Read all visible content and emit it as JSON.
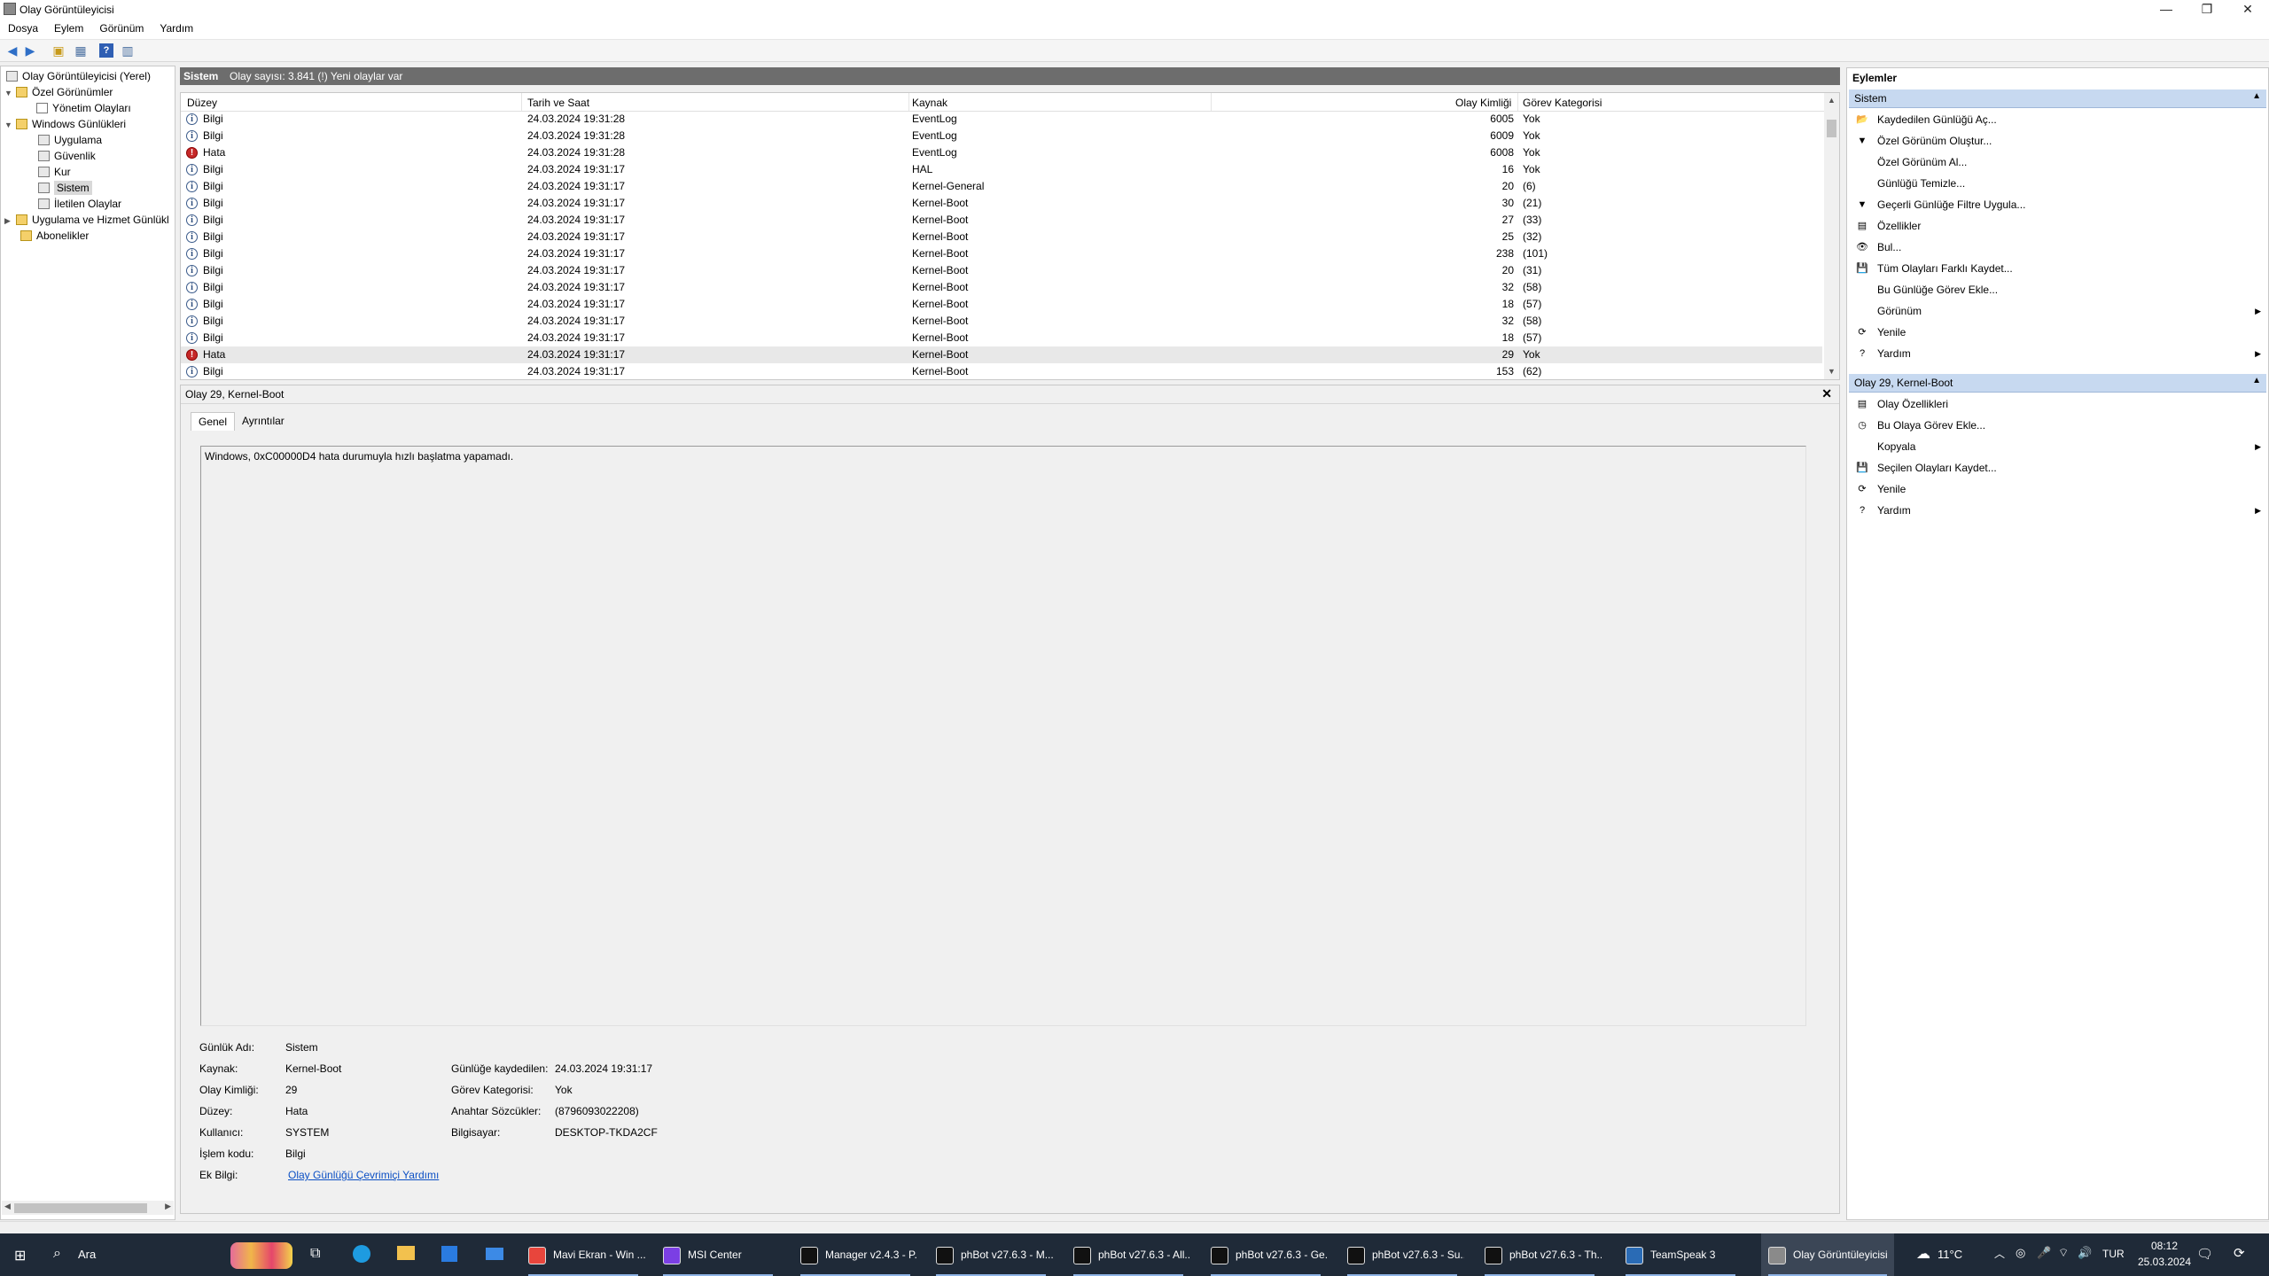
{
  "window": {
    "title": "Olay Görüntüleyicisi",
    "minimize_glyph": "—",
    "restore_glyph": "❐",
    "close_glyph": "✕"
  },
  "menu": [
    "Dosya",
    "Eylem",
    "Görünüm",
    "Yardım"
  ],
  "tree": {
    "root": "Olay Görüntüleyicisi (Yerel)",
    "custom_views": "Özel Görünümler",
    "admin_events": "Yönetim Olayları",
    "windows_logs": "Windows Günlükleri",
    "application": "Uygulama",
    "security": "Güvenlik",
    "setup": "Kur",
    "system": "Sistem",
    "forwarded": "İletilen Olaylar",
    "app_service_logs": "Uygulama ve Hizmet Günlükl",
    "subscriptions": "Abonelikler"
  },
  "center": {
    "header_title": "Sistem",
    "header_info": "Olay sayısı: 3.841 (!) Yeni olaylar var",
    "columns": [
      "Düzey",
      "Tarih ve Saat",
      "Kaynak",
      "Olay Kimliği",
      "Görev Kategorisi"
    ],
    "rows": [
      {
        "level": "Bilgi",
        "type": "info",
        "date": "24.03.2024 19:31:28",
        "source": "EventLog",
        "id": "6005",
        "task": "Yok"
      },
      {
        "level": "Bilgi",
        "type": "info",
        "date": "24.03.2024 19:31:28",
        "source": "EventLog",
        "id": "6009",
        "task": "Yok"
      },
      {
        "level": "Hata",
        "type": "err",
        "date": "24.03.2024 19:31:28",
        "source": "EventLog",
        "id": "6008",
        "task": "Yok"
      },
      {
        "level": "Bilgi",
        "type": "info",
        "date": "24.03.2024 19:31:17",
        "source": "HAL",
        "id": "16",
        "task": "Yok"
      },
      {
        "level": "Bilgi",
        "type": "info",
        "date": "24.03.2024 19:31:17",
        "source": "Kernel-General",
        "id": "20",
        "task": "(6)"
      },
      {
        "level": "Bilgi",
        "type": "info",
        "date": "24.03.2024 19:31:17",
        "source": "Kernel-Boot",
        "id": "30",
        "task": "(21)"
      },
      {
        "level": "Bilgi",
        "type": "info",
        "date": "24.03.2024 19:31:17",
        "source": "Kernel-Boot",
        "id": "27",
        "task": "(33)"
      },
      {
        "level": "Bilgi",
        "type": "info",
        "date": "24.03.2024 19:31:17",
        "source": "Kernel-Boot",
        "id": "25",
        "task": "(32)"
      },
      {
        "level": "Bilgi",
        "type": "info",
        "date": "24.03.2024 19:31:17",
        "source": "Kernel-Boot",
        "id": "238",
        "task": "(101)"
      },
      {
        "level": "Bilgi",
        "type": "info",
        "date": "24.03.2024 19:31:17",
        "source": "Kernel-Boot",
        "id": "20",
        "task": "(31)"
      },
      {
        "level": "Bilgi",
        "type": "info",
        "date": "24.03.2024 19:31:17",
        "source": "Kernel-Boot",
        "id": "32",
        "task": "(58)"
      },
      {
        "level": "Bilgi",
        "type": "info",
        "date": "24.03.2024 19:31:17",
        "source": "Kernel-Boot",
        "id": "18",
        "task": "(57)"
      },
      {
        "level": "Bilgi",
        "type": "info",
        "date": "24.03.2024 19:31:17",
        "source": "Kernel-Boot",
        "id": "32",
        "task": "(58)"
      },
      {
        "level": "Bilgi",
        "type": "info",
        "date": "24.03.2024 19:31:17",
        "source": "Kernel-Boot",
        "id": "18",
        "task": "(57)"
      },
      {
        "level": "Hata",
        "type": "err",
        "date": "24.03.2024 19:31:17",
        "source": "Kernel-Boot",
        "id": "29",
        "task": "Yok",
        "selected": true
      },
      {
        "level": "Bilgi",
        "type": "info",
        "date": "24.03.2024 19:31:17",
        "source": "Kernel-Boot",
        "id": "153",
        "task": "(62)"
      }
    ]
  },
  "detail": {
    "title": "Olay 29, Kernel-Boot",
    "close": "✕",
    "tabs": [
      "Genel",
      "Ayrıntılar"
    ],
    "message": "Windows, 0xC00000D4 hata durumuyla hızlı başlatma yapamadı.",
    "labels": {
      "log_name": "Günlük Adı:",
      "source": "Kaynak:",
      "event_id": "Olay Kimliği:",
      "level": "Düzey:",
      "user": "Kullanıcı:",
      "opcode": "İşlem kodu:",
      "more_info": "Ek Bilgi:",
      "logged": "Günlüğe kaydedilen:",
      "task_category": "Görev Kategorisi:",
      "keywords": "Anahtar Sözcükler:",
      "computer": "Bilgisayar:"
    },
    "values": {
      "log_name": "Sistem",
      "source": "Kernel-Boot",
      "event_id": "29",
      "level": "Hata",
      "user": "SYSTEM",
      "opcode": "Bilgi",
      "more_info_link": "Olay Günlüğü Çevrimiçi Yardımı",
      "logged": "24.03.2024 19:31:17",
      "task_category": "Yok",
      "keywords": "(8796093022208)",
      "computer": "DESKTOP-TKDA2CF"
    }
  },
  "actions": {
    "title": "Eylemler",
    "group1": "Sistem",
    "group1_items": [
      {
        "label": "Kaydedilen Günlüğü Aç...",
        "icon": "open-folder-icon",
        "glyph": "📂"
      },
      {
        "label": "Özel Görünüm Oluştur...",
        "icon": "filter-icon",
        "glyph": "▼"
      },
      {
        "label": "Özel Görünüm Al...",
        "icon": "",
        "glyph": ""
      },
      {
        "label": "Günlüğü Temizle...",
        "icon": "",
        "glyph": ""
      },
      {
        "label": "Geçerli Günlüğe Filtre Uygula...",
        "icon": "filter-icon",
        "glyph": "▼"
      },
      {
        "label": "Özellikler",
        "icon": "properties-icon",
        "glyph": "▤"
      },
      {
        "label": "Bul...",
        "icon": "binoculars-icon",
        "glyph": "👁"
      },
      {
        "label": "Tüm Olayları Farklı Kaydet...",
        "icon": "save-icon",
        "glyph": "💾"
      },
      {
        "label": "Bu Günlüğe Görev Ekle...",
        "icon": "",
        "glyph": ""
      },
      {
        "label": "Görünüm",
        "icon": "",
        "glyph": "",
        "submenu": true
      },
      {
        "label": "Yenile",
        "icon": "refresh-icon",
        "glyph": "⟳"
      },
      {
        "label": "Yardım",
        "icon": "help-icon",
        "glyph": "?",
        "submenu": true
      }
    ],
    "group2": "Olay 29, Kernel-Boot",
    "group2_items": [
      {
        "label": "Olay Özellikleri",
        "icon": "event-properties-icon",
        "glyph": "▤"
      },
      {
        "label": "Bu Olaya Görev Ekle...",
        "icon": "task-icon",
        "glyph": "◷"
      },
      {
        "label": "Kopyala",
        "icon": "",
        "glyph": "",
        "submenu": true
      },
      {
        "label": "Seçilen Olayları Kaydet...",
        "icon": "save-icon",
        "glyph": "💾"
      },
      {
        "label": "Yenile",
        "icon": "refresh-icon",
        "glyph": "⟳"
      },
      {
        "label": "Yardım",
        "icon": "help-icon",
        "glyph": "?",
        "submenu": true
      }
    ]
  },
  "taskbar": {
    "search_label": "Ara",
    "apps": [
      {
        "label": "Mavi Ekran - Win ...",
        "icon": "chrome-icon",
        "color": "#e8453c"
      },
      {
        "label": "MSI Center",
        "icon": "msi-center-icon",
        "color": "#7b3fe4"
      },
      {
        "label": "Manager v2.4.3 - P...",
        "icon": "phbot-manager-icon",
        "color": "#111111"
      },
      {
        "label": "phBot v27.6.3 - M...",
        "icon": "phbot-icon",
        "color": "#111111"
      },
      {
        "label": "phBot v27.6.3 - All...",
        "icon": "phbot-icon",
        "color": "#111111"
      },
      {
        "label": "phBot v27.6.3 - Ge...",
        "icon": "phbot-icon",
        "color": "#111111"
      },
      {
        "label": "phBot v27.6.3 - Su...",
        "icon": "phbot-icon",
        "color": "#111111"
      },
      {
        "label": "phBot v27.6.3 - Th...",
        "icon": "phbot-icon",
        "color": "#111111"
      },
      {
        "label": "TeamSpeak 3",
        "icon": "teamspeak-icon",
        "color": "#2a6bb5"
      },
      {
        "label": "Olay Görüntüleyicisi",
        "icon": "event-viewer-icon",
        "color": "#8a8a8a"
      }
    ],
    "weather": "11°C",
    "lang": "TUR",
    "time": "08:12",
    "date": "25.03.2024"
  }
}
